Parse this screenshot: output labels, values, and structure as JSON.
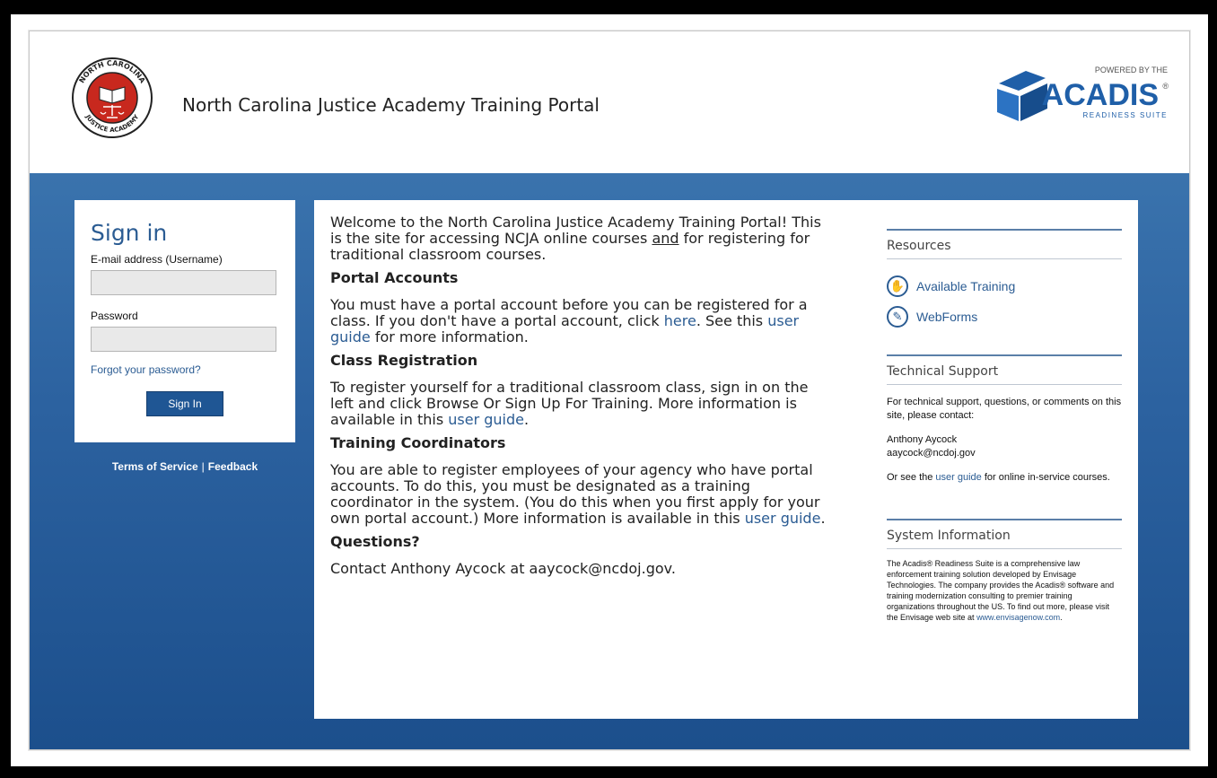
{
  "header": {
    "title": "North Carolina Justice Academy Training Portal",
    "seal_top_text": "NORTH CAROLINA",
    "seal_bottom_text": "JUSTICE ACADEMY",
    "acadis_powered": "POWERED BY THE",
    "acadis_name": "ACADIS",
    "acadis_reg": "®",
    "acadis_suite": "READINESS SUITE"
  },
  "signin": {
    "heading": "Sign in",
    "email_label": "E-mail address (Username)",
    "email_value": "",
    "password_label": "Password",
    "password_value": "",
    "forgot_link": "Forgot your password?",
    "button_label": "Sign In"
  },
  "footer": {
    "terms": "Terms of Service",
    "separator": "|",
    "feedback": "Feedback"
  },
  "welcome": {
    "intro_1": "Welcome to the North Carolina Justice Academy Training Portal! This is the site for accessing NCJA online courses ",
    "intro_and": "and",
    "intro_2": " for registering for traditional classroom courses.",
    "portal_heading": "Portal Accounts",
    "portal_1": "You must have a portal account before you can be registered for a class. If you don't have a portal account, click ",
    "portal_here": "here",
    "portal_2": ". See this ",
    "portal_guide": "user guide",
    "portal_3": " for more information.",
    "class_heading": "Class Registration",
    "class_1": "To register yourself for a traditional classroom class, sign in on the left and click Browse Or Sign Up For Training. More information is available in this ",
    "class_guide": "user guide",
    "class_2": ".",
    "coord_heading": "Training Coordinators",
    "coord_1": "You are able to register employees of your agency who have portal accounts. To do this, you must be designated as a training coordinator in the system. (You do this when you first apply for your own portal account.) More information is available in this ",
    "coord_guide": "user guide",
    "coord_2": ".",
    "questions_heading": "Questions?",
    "questions_text": "Contact Anthony Aycock at aaycock@ncdoj.gov."
  },
  "resources": {
    "title": "Resources",
    "items": [
      {
        "label": "Available Training",
        "icon": "training-icon",
        "glyph": "✋"
      },
      {
        "label": "WebForms",
        "icon": "webforms-icon",
        "glyph": "✎"
      }
    ]
  },
  "support": {
    "title": "Technical Support",
    "text": "For technical support, questions, or comments on this site, please contact:",
    "name": "Anthony Aycock",
    "email": "aaycock@ncdoj.gov",
    "or_see_1": "Or see the ",
    "or_see_link": "user guide",
    "or_see_2": " for online in-service courses."
  },
  "system": {
    "title": "System Information",
    "text": "The Acadis® Readiness Suite is a comprehensive law enforcement training solution developed by Envisage Technologies. The company provides the Acadis® software and training modernization consulting to premier training organizations throughout the US. To find out more, please visit the Envisage web site at ",
    "link": "www.envisagenow.com",
    "end": "."
  },
  "colors": {
    "brand_blue": "#2b5c93",
    "band_top": "#3a73ad",
    "band_bottom": "#1c4f8c",
    "seal_red": "#c8281e"
  }
}
